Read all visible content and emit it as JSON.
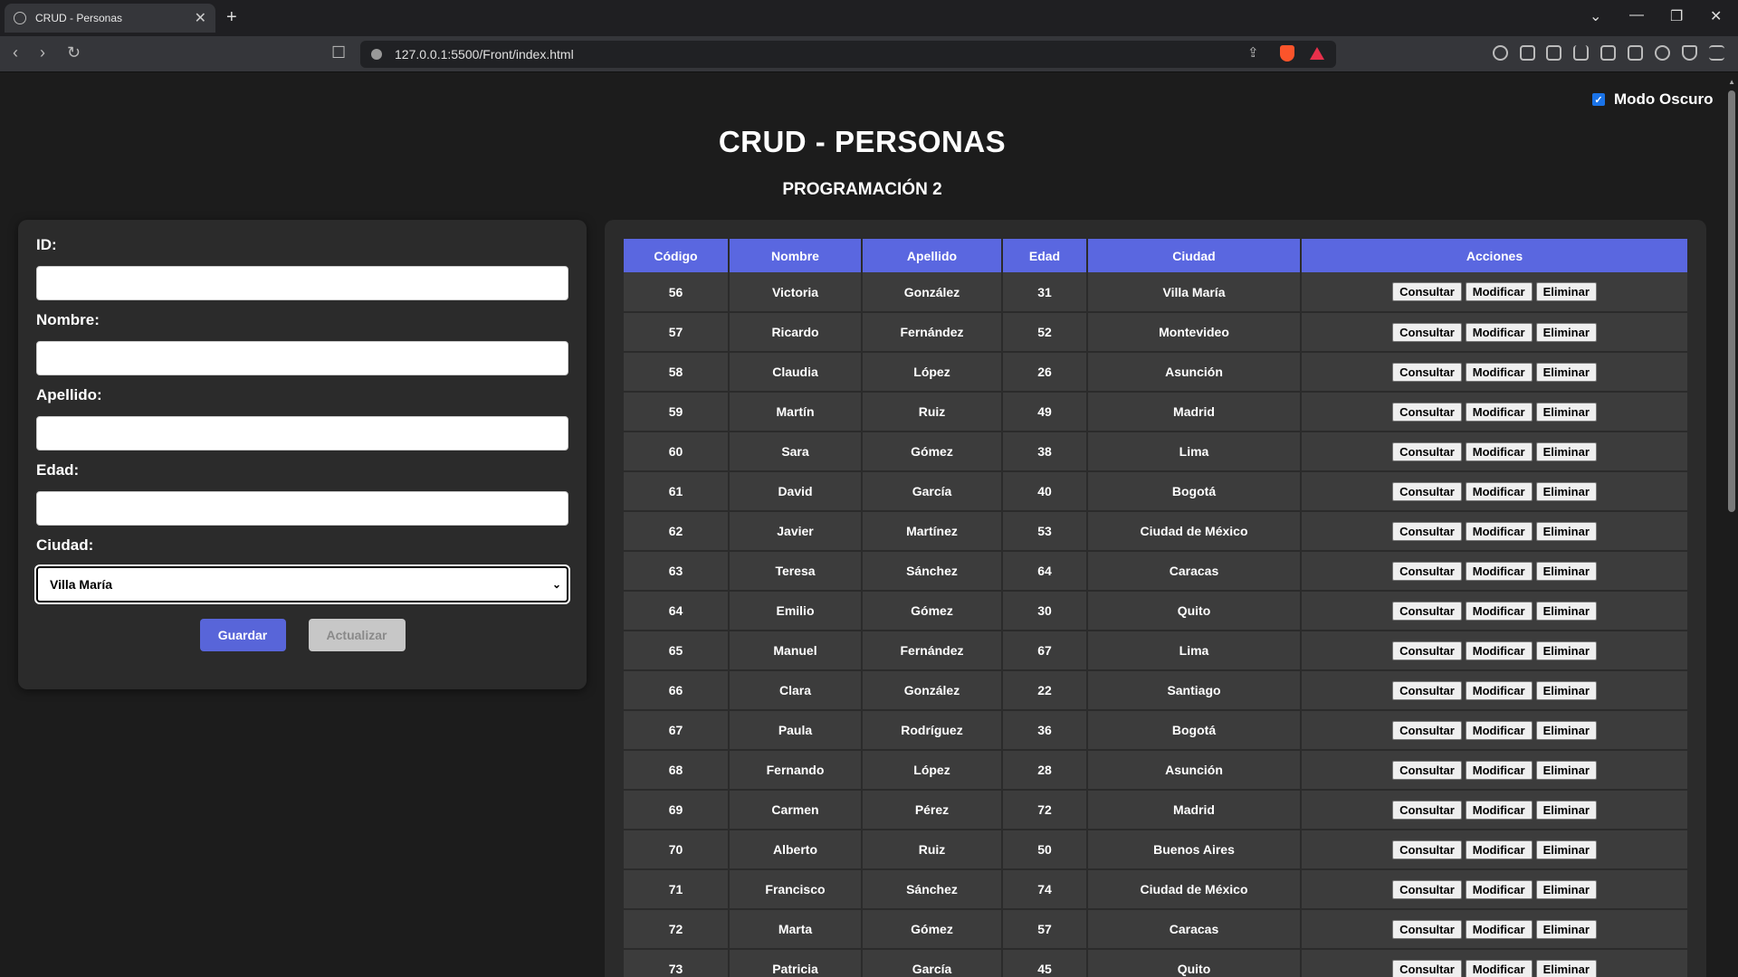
{
  "browser": {
    "tab_title": "CRUD - Personas",
    "url": "127.0.0.1:5500/Front/index.html"
  },
  "page": {
    "dark_mode_label": "Modo Oscuro",
    "dark_mode_checked": true,
    "title": "CRUD - PERSONAS",
    "subtitle": "PROGRAMACIÓN 2"
  },
  "form": {
    "id_label": "ID:",
    "nombre_label": "Nombre:",
    "apellido_label": "Apellido:",
    "edad_label": "Edad:",
    "ciudad_label": "Ciudad:",
    "ciudad_selected": "Villa María",
    "save_label": "Guardar",
    "update_label": "Actualizar"
  },
  "table": {
    "headers": [
      "Código",
      "Nombre",
      "Apellido",
      "Edad",
      "Ciudad",
      "Acciones"
    ],
    "actions": [
      "Consultar",
      "Modificar",
      "Eliminar"
    ],
    "rows": [
      [
        "56",
        "Victoria",
        "González",
        "31",
        "Villa María"
      ],
      [
        "57",
        "Ricardo",
        "Fernández",
        "52",
        "Montevideo"
      ],
      [
        "58",
        "Claudia",
        "López",
        "26",
        "Asunción"
      ],
      [
        "59",
        "Martín",
        "Ruiz",
        "49",
        "Madrid"
      ],
      [
        "60",
        "Sara",
        "Gómez",
        "38",
        "Lima"
      ],
      [
        "61",
        "David",
        "García",
        "40",
        "Bogotá"
      ],
      [
        "62",
        "Javier",
        "Martínez",
        "53",
        "Ciudad de México"
      ],
      [
        "63",
        "Teresa",
        "Sánchez",
        "64",
        "Caracas"
      ],
      [
        "64",
        "Emilio",
        "Gómez",
        "30",
        "Quito"
      ],
      [
        "65",
        "Manuel",
        "Fernández",
        "67",
        "Lima"
      ],
      [
        "66",
        "Clara",
        "González",
        "22",
        "Santiago"
      ],
      [
        "67",
        "Paula",
        "Rodríguez",
        "36",
        "Bogotá"
      ],
      [
        "68",
        "Fernando",
        "López",
        "28",
        "Asunción"
      ],
      [
        "69",
        "Carmen",
        "Pérez",
        "72",
        "Madrid"
      ],
      [
        "70",
        "Alberto",
        "Ruiz",
        "50",
        "Buenos Aires"
      ],
      [
        "71",
        "Francisco",
        "Sánchez",
        "74",
        "Ciudad de México"
      ],
      [
        "72",
        "Marta",
        "Gómez",
        "57",
        "Caracas"
      ],
      [
        "73",
        "Patricia",
        "García",
        "45",
        "Quito"
      ]
    ]
  }
}
